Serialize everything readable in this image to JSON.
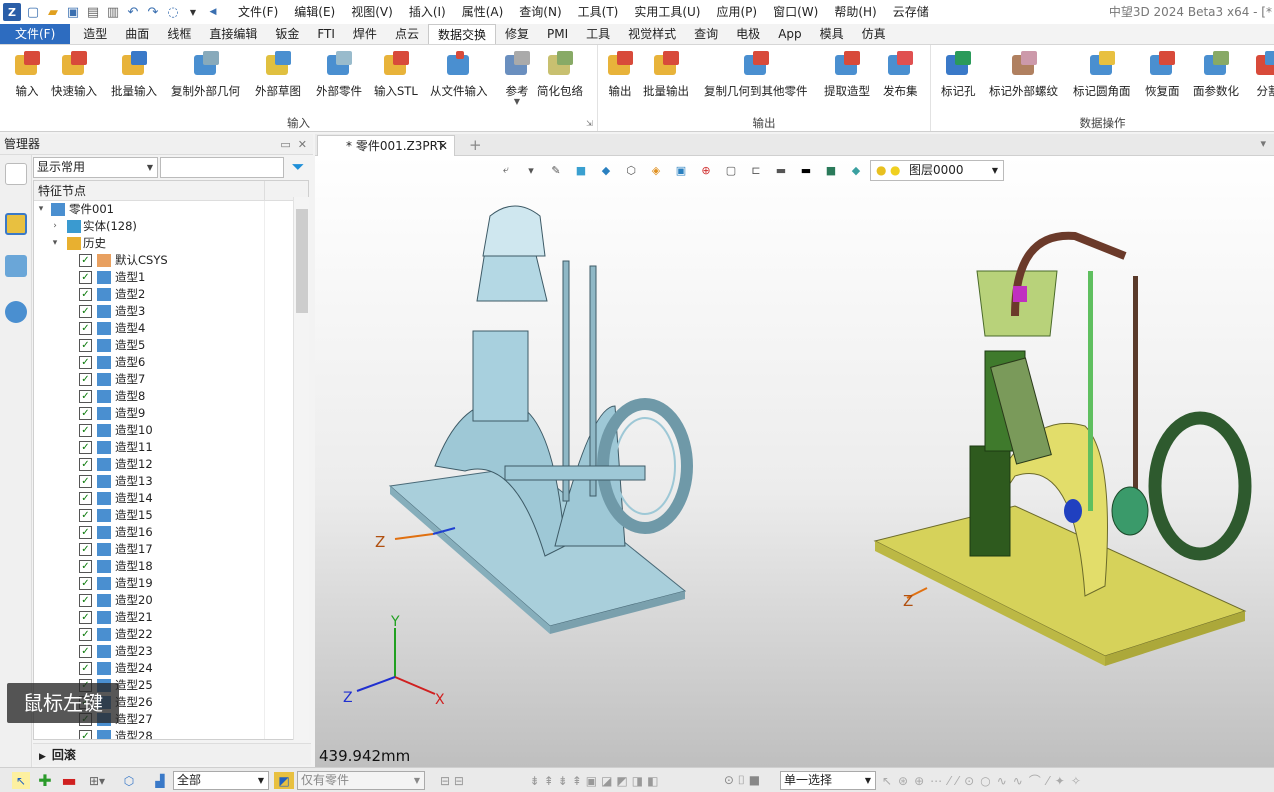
{
  "titlebar": {
    "logo": "Z",
    "window_title": "中望3D 2024 Beta3 x64 - [*",
    "menus": [
      "文件(F)",
      "编辑(E)",
      "视图(V)",
      "插入(I)",
      "属性(A)",
      "查询(N)",
      "工具(T)",
      "实用工具(U)",
      "应用(P)",
      "窗口(W)",
      "帮助(H)",
      "云存储"
    ]
  },
  "tabs": [
    "文件(F)",
    "造型",
    "曲面",
    "线框",
    "直接编辑",
    "钣金",
    "FTI",
    "焊件",
    "点云",
    "数据交换",
    "修复",
    "PMI",
    "工具",
    "视觉样式",
    "查询",
    "电极",
    "App",
    "模具",
    "仿真"
  ],
  "active_tab": "数据交换",
  "ribbon": {
    "input_group": {
      "label": "输入",
      "buttons": [
        "输入",
        "快速输入",
        "批量输入",
        "复制外部几何",
        "外部草图",
        "外部零件",
        "输入STL",
        "从文件输入",
        "参考",
        "简化包络"
      ]
    },
    "output_group": {
      "label": "输出",
      "buttons": [
        "输出",
        "批量输出",
        "复制几何到其他零件",
        "提取造型",
        "发布集"
      ]
    },
    "data_group": {
      "label": "数据操作",
      "buttons": [
        "标记孔",
        "标记外部螺纹",
        "标记圆角面",
        "恢复面",
        "面参数化",
        "分割"
      ]
    }
  },
  "manager": {
    "title": "管理器",
    "filter_value": "显示常用",
    "tree_header": "特征节点",
    "root": "零件001",
    "solid": "实体(128)",
    "history": "历史",
    "csys": "默认CSYS",
    "features": [
      "造型1",
      "造型2",
      "造型3",
      "造型4",
      "造型5",
      "造型6",
      "造型7",
      "造型8",
      "造型9",
      "造型10",
      "造型11",
      "造型12",
      "造型13",
      "造型14",
      "造型15",
      "造型16",
      "造型17",
      "造型18",
      "造型19",
      "造型20",
      "造型21",
      "造型22",
      "造型23",
      "造型24",
      "造型25",
      "造型26",
      "造型27",
      "造型28"
    ],
    "rollback": "回滚"
  },
  "document": {
    "tab": "* 零件001.Z3PRT",
    "layer": "图层0000",
    "scale": "439.942mm",
    "axes": {
      "x": "X",
      "y": "Y",
      "z": "Z"
    }
  },
  "mouse_tip": "鼠标左键",
  "statusbar": {
    "filter_all": "全部",
    "only_parts": "仅有零件",
    "select_mode": "单一选择"
  },
  "colors": {
    "accent": "#2d6cc0",
    "model_blue": "#9ec8d6",
    "yellow_base": "#d6d25a",
    "green": "#3f7a2c",
    "brown": "#6b3a2a"
  }
}
